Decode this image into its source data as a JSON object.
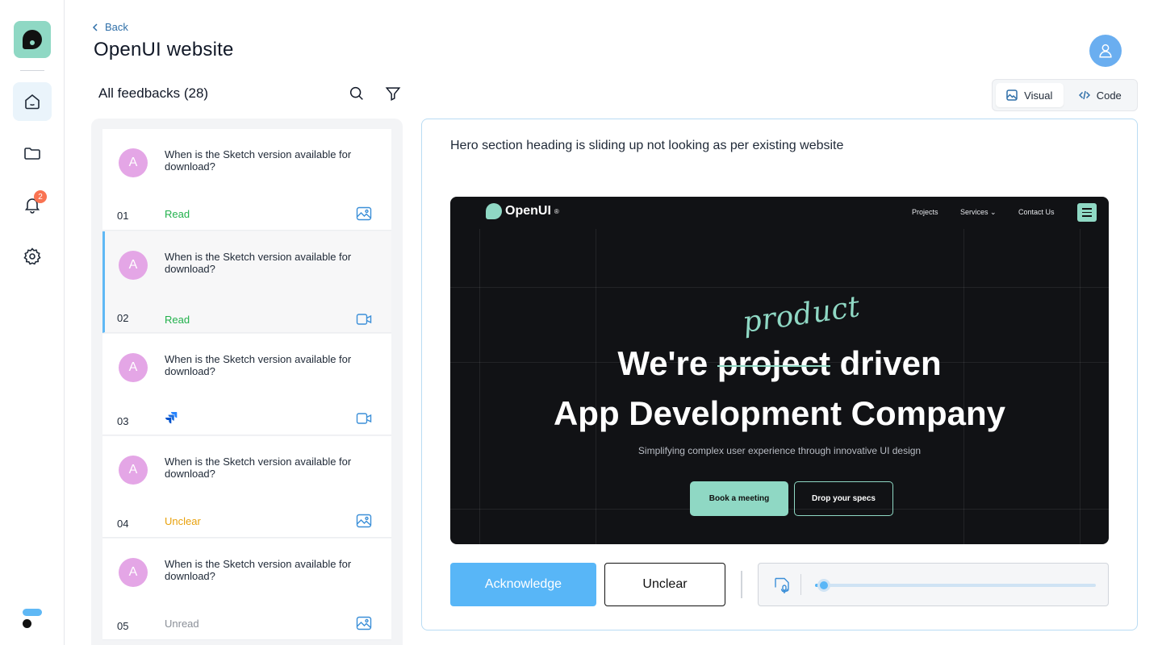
{
  "header": {
    "back_label": "Back",
    "title": "OpenUI website"
  },
  "sidebar": {
    "notification_count": "2",
    "items": [
      {
        "name": "home",
        "active": true
      },
      {
        "name": "folder",
        "active": false
      },
      {
        "name": "notifications",
        "active": false
      },
      {
        "name": "settings",
        "active": false
      }
    ]
  },
  "feedback_list": {
    "title": "All feedbacks (28)",
    "items": [
      {
        "number": "01",
        "text": "When is the Sketch version available for download?",
        "avatar": "A",
        "status": "Read",
        "media": "image-icon"
      },
      {
        "number": "02",
        "text": "When is the Sketch version available for download?",
        "avatar": "A",
        "status": "Read",
        "media": "video-icon"
      },
      {
        "number": "03",
        "text": "When is the Sketch version available for download?",
        "avatar": "A",
        "status": "",
        "media": "video-icon"
      },
      {
        "number": "04",
        "text": "When is the Sketch version available for download?",
        "avatar": "A",
        "status": "Unclear",
        "media": "image-icon"
      },
      {
        "number": "05",
        "text": "When is the Sketch version available for download?",
        "avatar": "A",
        "status": "Unread",
        "media": "image-icon"
      }
    ]
  },
  "view_toggle": {
    "visual_label": "Visual",
    "code_label": "Code"
  },
  "detail": {
    "description": "Hero section heading is sliding up not looking as per existing website",
    "preview": {
      "logo": "OpenUI",
      "logo_mark": "®",
      "nav": [
        "Projects",
        "Services",
        "Contact Us"
      ],
      "handwritten": "product",
      "heading_prefix": "We're",
      "heading_struck": "project",
      "heading_suffix": "driven",
      "heading_line2": "App Development Company",
      "subtitle": "Simplifying complex user experience through innovative UI design",
      "primary_cta": "Book a meeting",
      "secondary_cta": "Drop your specs"
    },
    "acknowledge_label": "Acknowledge",
    "unclear_label": "Unclear",
    "audio_progress": 0.02
  },
  "colors": {
    "accent": "#58b6f7",
    "brand_mint": "#8fd8c4",
    "read": "#22b14c",
    "unclear": "#e8a10c",
    "unread": "#8a8f98"
  }
}
